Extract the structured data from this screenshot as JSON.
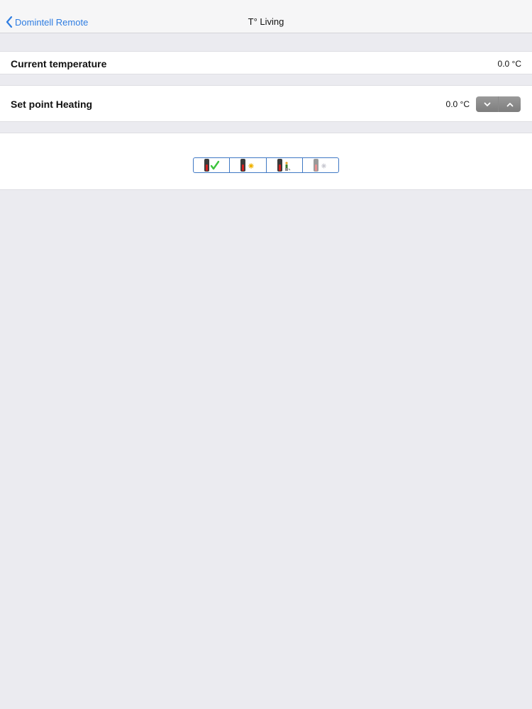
{
  "navbar": {
    "back_label": "Domintell Remote",
    "title": "T° Living"
  },
  "current_temperature": {
    "label": "Current temperature",
    "value": "0.0 °C"
  },
  "set_point_heating": {
    "label": "Set point Heating",
    "value": "0.0 °C"
  },
  "modes": {
    "items": [
      {
        "icon": "thermostat-check-icon"
      },
      {
        "icon": "thermostat-sun-icon"
      },
      {
        "icon": "thermostat-person-icon"
      },
      {
        "icon": "thermostat-snowflake-icon"
      }
    ]
  },
  "colors": {
    "accent": "#2f7de1",
    "background": "#ebebf0",
    "mode_border": "#3f78c4",
    "stepper": "#8a8a8a"
  }
}
